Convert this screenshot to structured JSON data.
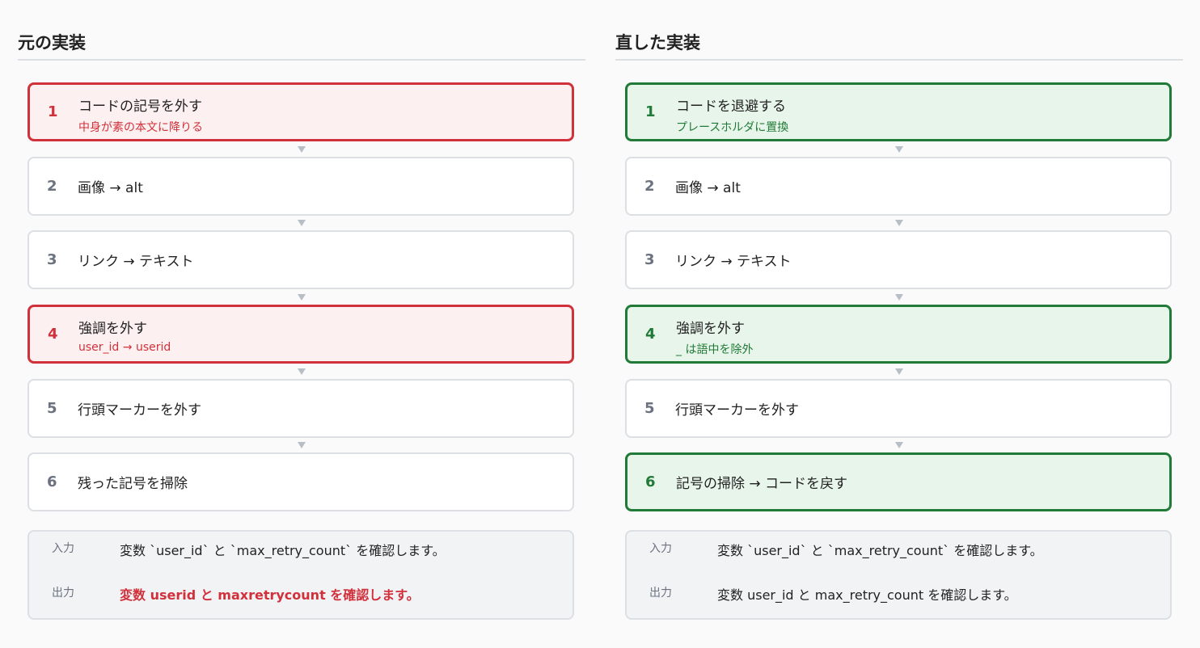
{
  "left": {
    "title": "元の実装",
    "steps": [
      {
        "num": "1",
        "label": "コードの記号を外す",
        "sub": "中身が素の本文に降りる"
      },
      {
        "num": "2",
        "label": "画像 → alt"
      },
      {
        "num": "3",
        "label": "リンク → テキスト"
      },
      {
        "num": "4",
        "label": "強調を外す",
        "sub": "user_id → userid"
      },
      {
        "num": "5",
        "label": "行頭マーカーを外す"
      },
      {
        "num": "6",
        "label": "残った記号を掃除"
      }
    ],
    "io": {
      "input_label": "入力",
      "input_value": "変数 `user_id` と `max_retry_count` を確認します。",
      "output_label": "出力",
      "output_value": "変数 userid と maxretrycount を確認します。"
    }
  },
  "right": {
    "title": "直した実装",
    "steps": [
      {
        "num": "1",
        "label": "コードを退避する",
        "sub": "プレースホルダに置換"
      },
      {
        "num": "2",
        "label": "画像 → alt"
      },
      {
        "num": "3",
        "label": "リンク → テキスト"
      },
      {
        "num": "4",
        "label": "強調を外す",
        "sub": "_ は語中を除外"
      },
      {
        "num": "5",
        "label": "行頭マーカーを外す"
      },
      {
        "num": "6",
        "label": "記号の掃除 → コードを戻す"
      }
    ],
    "io": {
      "input_label": "入力",
      "input_value": "変数 `user_id` と `max_retry_count` を確認します。",
      "output_label": "出力",
      "output_value": "変数 user_id と max_retry_count を確認します。"
    }
  },
  "colors": {
    "error": "#d1313b",
    "success": "#217a37",
    "neutral_border": "#dcdfe3"
  }
}
